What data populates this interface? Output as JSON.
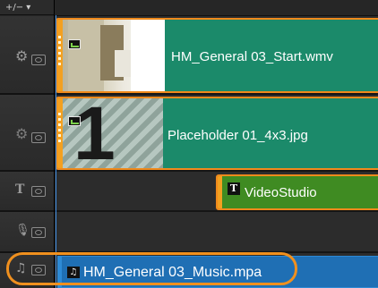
{
  "toolbar": {
    "track_manager_label": "+/− ▾"
  },
  "tracks": {
    "video_clip": {
      "label": "HM_General 03_Start.wmv"
    },
    "overlay_clip": {
      "label": "Placeholder 01_4x3.jpg",
      "thumb_glyph": "1"
    },
    "title_clip": {
      "label": "VideoStudio",
      "badge": "T"
    },
    "music_clip": {
      "label": "HM_General 03_Music.mpa",
      "badge": "♫"
    }
  },
  "icons": {
    "video_track": "film-reel-icon",
    "overlay_track": "overlay-film-reel-icon",
    "title_track": "title-T-icon",
    "voice_track": "microphone-icon",
    "music_track": "music-note-icon",
    "visibility": "eye-toggle-icon"
  },
  "colors": {
    "video_clip": "#1b8a6a",
    "title_clip": "#3f8b22",
    "music_clip": "#1f6fb4",
    "selection_border": "#f08a1c",
    "highlight_ring": "#f0901e"
  }
}
